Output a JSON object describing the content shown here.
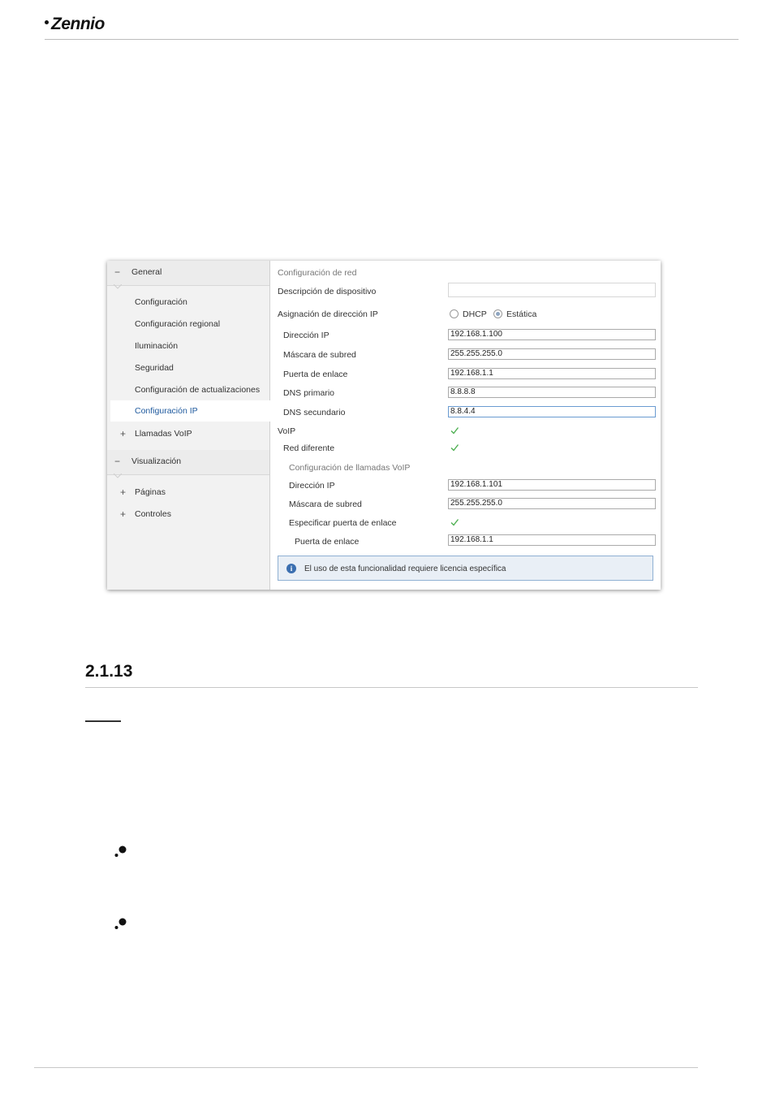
{
  "header": {
    "logo_text": "Zennio"
  },
  "sidebar": {
    "group_general": "General",
    "items": [
      "Configuración",
      "Configuración regional",
      "Iluminación",
      "Seguridad",
      "Configuración de actualizaciones"
    ],
    "active_item": "Configuración IP",
    "llamadas_voip": "Llamadas VoIP",
    "group_visualizacion": "Visualización",
    "paginas": "Páginas",
    "controles": "Controles",
    "minus": "−",
    "plus": "+"
  },
  "form": {
    "section_title": "Configuración de red",
    "descripcion_label": "Descripción de dispositivo",
    "descripcion_value": "",
    "asignacion_label": "Asignación de dirección IP",
    "dhcp_label": "DHCP",
    "estatica_label": "Estática",
    "selected_mode": "Estática",
    "direccion_ip_label": "Dirección IP",
    "direccion_ip_value": "192.168.1.100",
    "mascara_label": "Máscara de subred",
    "mascara_value": "255.255.255.0",
    "puerta_label": "Puerta de enlace",
    "puerta_value": "192.168.1.1",
    "dns1_label": "DNS primario",
    "dns1_value": "8.8.8.8",
    "dns2_label": "DNS secundario",
    "dns2_value": "8.8.4.4",
    "voip_label": "VoIP",
    "voip_checked": true,
    "red_diferente_label": "Red diferente",
    "red_diferente_checked": true,
    "voip_section_title": "Configuración de llamadas VoIP",
    "voip_ip_label": "Dirección IP",
    "voip_ip_value": "192.168.1.101",
    "voip_mask_label": "Máscara de subred",
    "voip_mask_value": "255.255.255.0",
    "especificar_label": "Especificar puerta de enlace",
    "especificar_checked": true,
    "voip_gw_label": "Puerta de enlace",
    "voip_gw_value": "192.168.1.1",
    "info_text": "El uso de esta funcionalidad requiere licencia específica",
    "info_icon": "i"
  },
  "document": {
    "section_number": "2.1.13"
  },
  "colors": {
    "accent": "#1f5a9e",
    "check": "#4caf50",
    "info_bg": "#e9eff6"
  }
}
